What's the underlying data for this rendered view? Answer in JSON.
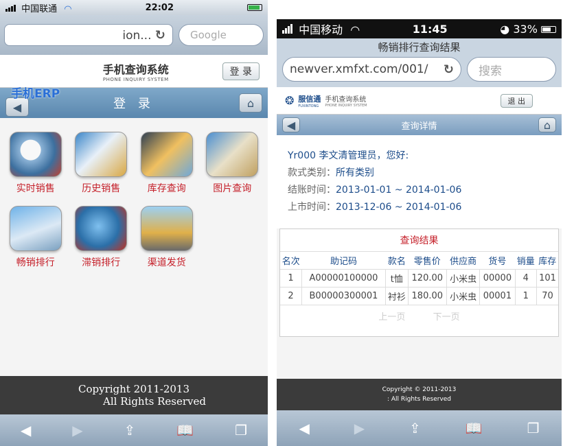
{
  "phone1": {
    "carrier": "中国联通",
    "time": "22:02",
    "url": "ion...",
    "search_placeholder": "Google",
    "brand_cn": "手机查询系统",
    "brand_en": "PHONE INQUIRY SYSTEM",
    "login_btn": "登 录",
    "erp_label": "手机ERP",
    "nav_title": "登 录",
    "tiles": [
      "实时销售",
      "历史销售",
      "库存查询",
      "图片查询",
      "畅销排行",
      "滞销排行",
      "渠道发货"
    ],
    "footer_line1": "Copyright  2011-2013",
    "footer_line2": "All Rights Reserved"
  },
  "phone2": {
    "carrier": "中国移动",
    "time": "11:45",
    "battery": "33%",
    "page_title": "畅销排行查询结果",
    "url": "newver.xmfxt.com/001/",
    "search_placeholder": "搜索",
    "brand_logo": "服信通",
    "brand_logo_en": "FUXINTONG",
    "brand_cn": "手机查询系统",
    "brand_en": "PHONE INQUIRY SYSTEM",
    "logout_btn": "退 出",
    "nav_title": "查询详情",
    "greeting": "Yr000 李文清管理员，您好:",
    "type_label": "款式类别：",
    "type_value": "所有类别",
    "settle_label": "结账时间：",
    "settle_value": "2013-01-01 ~ 2014-01-06",
    "market_label": "上市时间：",
    "market_value": "2013-12-06 ~ 2014-01-06",
    "result_title": "查询结果",
    "columns": [
      "名次",
      "助记码",
      "款名",
      "零售价",
      "供应商",
      "货号",
      "销量",
      "库存"
    ],
    "rows": [
      [
        "1",
        "A00000100000",
        "t恤",
        "120.00",
        "小米虫",
        "00000",
        "4",
        "101"
      ],
      [
        "2",
        "B00000300001",
        "衬衫",
        "180.00",
        "小米虫",
        "00001",
        "1",
        "70"
      ]
    ],
    "prev_page": "上一页",
    "next_page": "下一页",
    "footer_line1": "Copyright © 2011-2013",
    "footer_line2": ": All Rights Reserved"
  },
  "colors": {
    "accent_red": "#c5202a",
    "link_blue": "#1c4c8a",
    "nav_blue": "#5a87ae"
  }
}
